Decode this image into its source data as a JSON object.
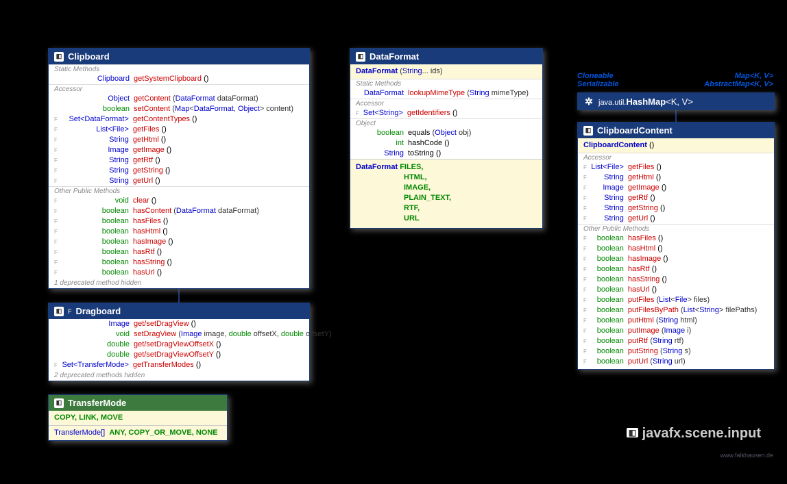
{
  "clipboard": {
    "title": "Clipboard",
    "sec1": "Static Methods",
    "m1": {
      "ret": "Clipboard",
      "name": "getSystemClipboard",
      "params": "()"
    },
    "sec2": "Accessor",
    "m2": {
      "ret": "Object",
      "name": "getContent",
      "params": "(DataFormat dataFormat)"
    },
    "m3": {
      "ret": "boolean",
      "name": "setContent",
      "params": "(Map<DataFormat, Object> content)"
    },
    "m4": {
      "ret": "Set<DataFormat>",
      "name": "getContentTypes",
      "params": "()"
    },
    "m5": {
      "ret": "List<File>",
      "name": "getFiles",
      "params": "()"
    },
    "m6": {
      "ret": "String",
      "name": "getHtml",
      "params": "()"
    },
    "m7": {
      "ret": "Image",
      "name": "getImage",
      "params": "()"
    },
    "m8": {
      "ret": "String",
      "name": "getRtf",
      "params": "()"
    },
    "m9": {
      "ret": "String",
      "name": "getString",
      "params": "()"
    },
    "m10": {
      "ret": "String",
      "name": "getUrl",
      "params": "()"
    },
    "sec3": "Other Public Methods",
    "m11": {
      "ret": "void",
      "name": "clear",
      "params": "()"
    },
    "m12": {
      "ret": "boolean",
      "name": "hasContent",
      "params": "(DataFormat dataFormat)"
    },
    "m13": {
      "ret": "boolean",
      "name": "hasFiles",
      "params": "()"
    },
    "m14": {
      "ret": "boolean",
      "name": "hasHtml",
      "params": "()"
    },
    "m15": {
      "ret": "boolean",
      "name": "hasImage",
      "params": "()"
    },
    "m16": {
      "ret": "boolean",
      "name": "hasRtf",
      "params": "()"
    },
    "m17": {
      "ret": "boolean",
      "name": "hasString",
      "params": "()"
    },
    "m18": {
      "ret": "boolean",
      "name": "hasUrl",
      "params": "()"
    },
    "dep": "1 deprecated method hidden"
  },
  "dragboard": {
    "title": "Dragboard",
    "m1": {
      "ret": "Image",
      "name": "get/setDragView",
      "params": "()"
    },
    "m2": {
      "ret": "void",
      "name": "setDragView",
      "params": "(Image image, double offsetX, double offsetY)"
    },
    "m3": {
      "ret": "double",
      "name": "get/setDragViewOffsetX",
      "params": "()"
    },
    "m4": {
      "ret": "double",
      "name": "get/setDragViewOffsetY",
      "params": "()"
    },
    "m5": {
      "ret": "Set<TransferMode>",
      "name": "getTransferModes",
      "params": "()"
    },
    "dep": "2 deprecated methods hidden"
  },
  "transfermode": {
    "title": "TransferMode",
    "vals": "COPY, LINK, MOVE",
    "arr": "TransferMode[]",
    "consts": "ANY, COPY_OR_MOVE, NONE"
  },
  "dataformat": {
    "title": "DataFormat",
    "ctor": {
      "ret": "DataFormat",
      "params": "(String... ids)"
    },
    "sec1": "Static Methods",
    "m1": {
      "ret": "DataFormat",
      "name": "lookupMimeType",
      "params": "(String mimeType)"
    },
    "sec2": "Accessor",
    "m2": {
      "ret": "Set<String>",
      "name": "getIdentifiers",
      "params": "()"
    },
    "sec3": "Object",
    "m3": {
      "ret": "boolean",
      "name": "equals",
      "params": "(Object obj)"
    },
    "m4": {
      "ret": "int",
      "name": "hashCode",
      "params": "()"
    },
    "m5": {
      "ret": "String",
      "name": "toString",
      "params": "()"
    },
    "fret": "DataFormat",
    "f1": "FILES,",
    "f2": "HTML,",
    "f3": "IMAGE,",
    "f4": "PLAIN_TEXT,",
    "f5": "RTF,",
    "f6": "URL"
  },
  "hashmap": {
    "pkg": "java.util.",
    "name": "HashMap",
    "generics": "<K, V>"
  },
  "ifaces": {
    "c": "Cloneable",
    "s": "Serializable",
    "m": "Map<K, V>",
    "am": "AbstractMap<K, V>"
  },
  "cc": {
    "title": "ClipboardContent",
    "ctor": {
      "ret": "ClipboardContent",
      "params": "()"
    },
    "sec1": "Accessor",
    "m1": {
      "ret": "List<File>",
      "name": "getFiles",
      "params": "()"
    },
    "m2": {
      "ret": "String",
      "name": "getHtml",
      "params": "()"
    },
    "m3": {
      "ret": "Image",
      "name": "getImage",
      "params": "()"
    },
    "m4": {
      "ret": "String",
      "name": "getRtf",
      "params": "()"
    },
    "m5": {
      "ret": "String",
      "name": "getString",
      "params": "()"
    },
    "m6": {
      "ret": "String",
      "name": "getUrl",
      "params": "()"
    },
    "sec2": "Other Public Methods",
    "m7": {
      "ret": "boolean",
      "name": "hasFiles",
      "params": "()"
    },
    "m8": {
      "ret": "boolean",
      "name": "hasHtml",
      "params": "()"
    },
    "m9": {
      "ret": "boolean",
      "name": "hasImage",
      "params": "()"
    },
    "m10": {
      "ret": "boolean",
      "name": "hasRtf",
      "params": "()"
    },
    "m11": {
      "ret": "boolean",
      "name": "hasString",
      "params": "()"
    },
    "m12": {
      "ret": "boolean",
      "name": "hasUrl",
      "params": "()"
    },
    "m13": {
      "ret": "boolean",
      "name": "putFiles",
      "params": "(List<File> files)"
    },
    "m14": {
      "ret": "boolean",
      "name": "putFilesByPath",
      "params": "(List<String> filePaths)"
    },
    "m15": {
      "ret": "boolean",
      "name": "putHtml",
      "params": "(String html)"
    },
    "m16": {
      "ret": "boolean",
      "name": "putImage",
      "params": "(Image i)"
    },
    "m17": {
      "ret": "boolean",
      "name": "putRtf",
      "params": "(String rtf)"
    },
    "m18": {
      "ret": "boolean",
      "name": "putString",
      "params": "(String s)"
    },
    "m19": {
      "ret": "boolean",
      "name": "putUrl",
      "params": "(String url)"
    }
  },
  "package": "javafx.scene.input",
  "credit": "www.falkhausen.de"
}
